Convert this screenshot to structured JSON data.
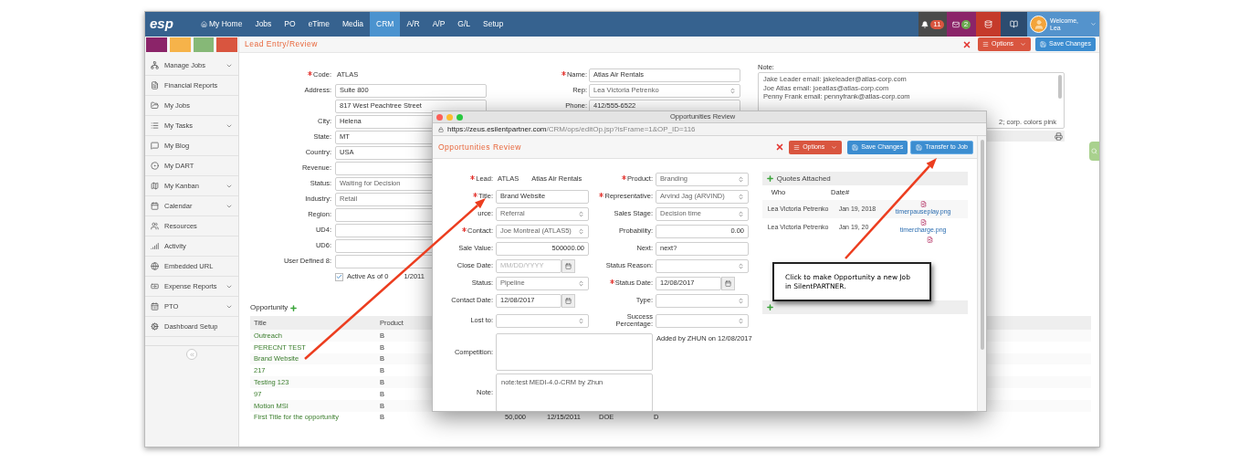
{
  "nav": {
    "logo": "esp",
    "items": [
      {
        "label": "My Home",
        "selected": false
      },
      {
        "label": "Jobs",
        "selected": false
      },
      {
        "label": "PO",
        "selected": false
      },
      {
        "label": "eTime",
        "selected": false
      },
      {
        "label": "Media",
        "selected": false
      },
      {
        "label": "CRM",
        "selected": true
      },
      {
        "label": "A/R",
        "selected": false
      },
      {
        "label": "A/P",
        "selected": false
      },
      {
        "label": "G/L",
        "selected": false
      },
      {
        "label": "Setup",
        "selected": false
      }
    ],
    "notifications": "11",
    "messages": "2",
    "user": {
      "greeting": "Welcome,",
      "name": "Lea"
    }
  },
  "color_swatches": [
    {
      "color": "#8b2469"
    },
    {
      "color": "#f6b34a"
    },
    {
      "color": "#86b877"
    },
    {
      "color": "#d9553f"
    }
  ],
  "sidebar": {
    "items": [
      {
        "label": "Manage Jobs",
        "expandable": true
      },
      {
        "label": "Financial Reports",
        "expandable": false
      },
      {
        "label": "My Jobs",
        "expandable": false
      },
      {
        "label": "My Tasks",
        "expandable": true
      },
      {
        "label": "My Blog",
        "expandable": false
      },
      {
        "label": "My DART",
        "expandable": false
      },
      {
        "label": "My Kanban",
        "expandable": true
      },
      {
        "label": "Calendar",
        "expandable": true
      },
      {
        "label": "Resources",
        "expandable": false
      },
      {
        "label": "Activity",
        "expandable": false
      },
      {
        "label": "Embedded URL",
        "expandable": false
      },
      {
        "label": "Expense Reports",
        "expandable": true
      },
      {
        "label": "PTO",
        "expandable": true
      },
      {
        "label": "Dashboard Setup",
        "expandable": false
      }
    ]
  },
  "page": {
    "title": "Lead Entry/Review",
    "options": "Options",
    "save": "Save Changes"
  },
  "lead_form": {
    "left": [
      {
        "label": "Code:",
        "required": true,
        "kind": "text",
        "value": "ATLAS"
      },
      {
        "label": "Address:",
        "required": false,
        "kind": "input",
        "value": "Suite 800"
      },
      {
        "kind": "input",
        "value": "817 West Peachtree Street"
      },
      {
        "label": "City:",
        "required": false,
        "kind": "input",
        "value": "Helena"
      },
      {
        "label": "State:",
        "required": false,
        "kind": "input",
        "value": "MT"
      },
      {
        "label": "Country:",
        "required": false,
        "kind": "input",
        "value": "USA"
      },
      {
        "label": "Revenue:",
        "required": false,
        "kind": "input"
      },
      {
        "label": "Status:",
        "required": false,
        "kind": "select",
        "value": "Waiting for Decision"
      },
      {
        "label": "Industry:",
        "required": false,
        "kind": "select",
        "value": "Retail"
      },
      {
        "label": "Region:",
        "required": false,
        "kind": "input"
      },
      {
        "label": "UD4:",
        "required": false,
        "kind": "input"
      },
      {
        "label": "UD6:",
        "required": false,
        "kind": "input"
      },
      {
        "label": "User Defined 8:",
        "required": false,
        "kind": "input"
      }
    ],
    "active": {
      "label": "Active As of 0",
      "label_tail": "1/2011",
      "checked": true
    },
    "right": [
      {
        "label": "Name:",
        "required": true,
        "kind": "input",
        "value": "Atlas Air Rentals"
      },
      {
        "label": "Rep:",
        "required": false,
        "kind": "select",
        "value": "Lea Victoria Petrenko"
      },
      {
        "label": "Phone:",
        "required": false,
        "kind": "input",
        "value": "412/555-6522"
      }
    ],
    "note": {
      "label": "Note:",
      "lines": [
        "Jake Leader email: jakeleader@atlas-corp.com",
        "Joe Atlas email: joeatlas@atlas-corp.com",
        "Penny Frank email: pennyfrank@atlas-corp.com"
      ],
      "cut_line": "2; corp. colors pink"
    }
  },
  "opportunity": {
    "title": "Opportunity",
    "columns": [
      "Title",
      "Product"
    ],
    "rows": [
      {
        "title": "Outreach",
        "product": "B"
      },
      {
        "title": "PERECNT TEST",
        "product": "B"
      },
      {
        "title": "Brand Website",
        "product": "B"
      },
      {
        "title": "217",
        "product": "B"
      },
      {
        "title": "Testing 123",
        "product": "B"
      },
      {
        "title": "97",
        "product": "B"
      },
      {
        "title": "Motion MSI",
        "product": "B"
      },
      {
        "title": "First Title for the opportunity",
        "product": "B",
        "column_3": "50,000",
        "column_4": "12/15/2011",
        "column_5": "DOE",
        "column_6": "D"
      }
    ]
  },
  "popup": {
    "window_title": "Opportunities Review",
    "url_host": "https://zeus.esilentpartner.com",
    "url_path": "/CRM/ops/editOp.jsp?isFrame=1&OP_ID=116",
    "title": "Opportunities Review",
    "options": "Options",
    "save": "Save Changes",
    "transfer": "Transfer to Job",
    "rows": [
      [
        {
          "label": "Lead:",
          "required": true,
          "kind": "pair",
          "value": "ATLAS",
          "value2": "Atlas Air Rentals"
        },
        {
          "label": "Product:",
          "required": true,
          "kind": "select",
          "value": "Branding"
        }
      ],
      [
        {
          "label": "Title:",
          "required": true,
          "kind": "input",
          "value": "Brand Website"
        },
        {
          "label": "Representative:",
          "required": true,
          "kind": "select",
          "value": "Arvind Jag (ARVIND)"
        }
      ],
      [
        {
          "label": "urce:",
          "required": false,
          "kind": "select",
          "value": "Referral"
        },
        {
          "label": "Sales Stage:",
          "required": false,
          "kind": "select",
          "value": "Decision time"
        }
      ],
      [
        {
          "label": "Contact:",
          "required": true,
          "kind": "select",
          "value": "Joe Montreal (ATLAS5)"
        },
        {
          "label": "Probability:",
          "required": false,
          "kind": "number",
          "value": "0.00"
        }
      ],
      [
        {
          "label": "Sale Value:",
          "required": false,
          "kind": "number",
          "value": "500000.00"
        },
        {
          "label": "Next:",
          "required": false,
          "kind": "input",
          "value": "next?"
        }
      ],
      [
        {
          "label": "Close Date:",
          "required": false,
          "kind": "date",
          "placeholder": "MM/DD/YYYY"
        },
        {
          "label": "Status Reason:",
          "required": false,
          "kind": "select"
        }
      ],
      [
        {
          "label": "Status:",
          "required": false,
          "kind": "select",
          "value": "Pipeline"
        },
        {
          "label": "Status Date:",
          "required": true,
          "kind": "date",
          "value": "12/08/2017"
        }
      ],
      [
        {
          "label": "Contact Date:",
          "required": false,
          "kind": "date",
          "value": "12/08/2017"
        },
        {
          "label": "Type:",
          "required": false,
          "kind": "select"
        }
      ],
      [
        {
          "label": "Lost to:",
          "required": false,
          "kind": "select"
        },
        {
          "label": "Success Percentage:",
          "required": false,
          "kind": "select"
        }
      ]
    ],
    "competition": {
      "label": "Competition:"
    },
    "added_by": "Added by ZHUN on 12/08/2017",
    "note": {
      "label": "Note:",
      "value": "note:test MEDI-4.0-CRM by Zhun"
    },
    "quotes": {
      "title": "Quotes Attached",
      "columns": [
        "Who",
        "Date#"
      ],
      "rows": [
        {
          "kind": "quote",
          "who": "Lea Victoria Petrenko",
          "date": "Jan 19, 2018",
          "file": "timerpauseplay.png"
        },
        {
          "kind": "quote",
          "who": "Lea Victoria Petrenko",
          "date": "Jan 19, 20",
          "file": "timercharge.png"
        },
        {
          "kind": "attachment"
        }
      ]
    }
  },
  "callout": {
    "text": "Click to make Opportunity a new Job in SilentPARTNER."
  }
}
